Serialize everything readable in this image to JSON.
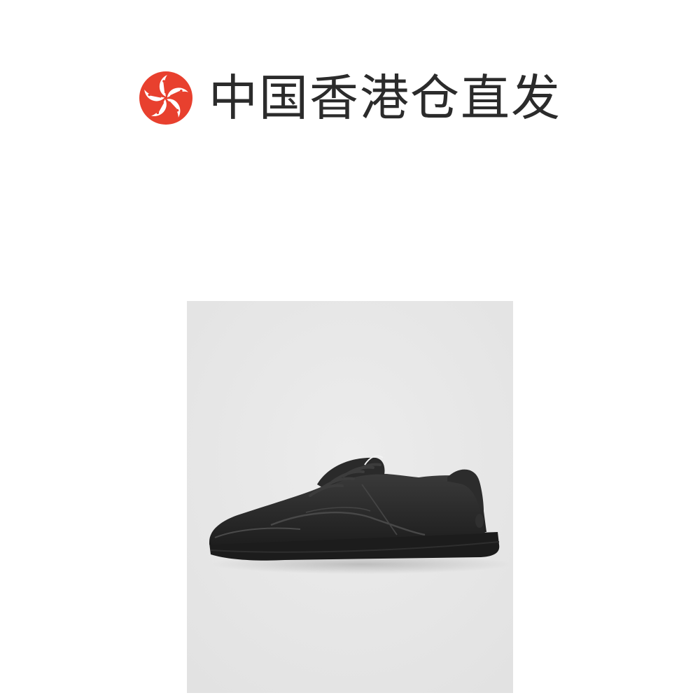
{
  "banner": {
    "logo_icon": "hong-kong-bauhinia-flag-icon",
    "logo_color": "#e8402e",
    "text": "中国香港仓直发",
    "text_color": "#2b2b2b"
  },
  "product_image": {
    "subject": "black-leather-low-top-sneaker",
    "background_color": "#e8e8e8"
  }
}
